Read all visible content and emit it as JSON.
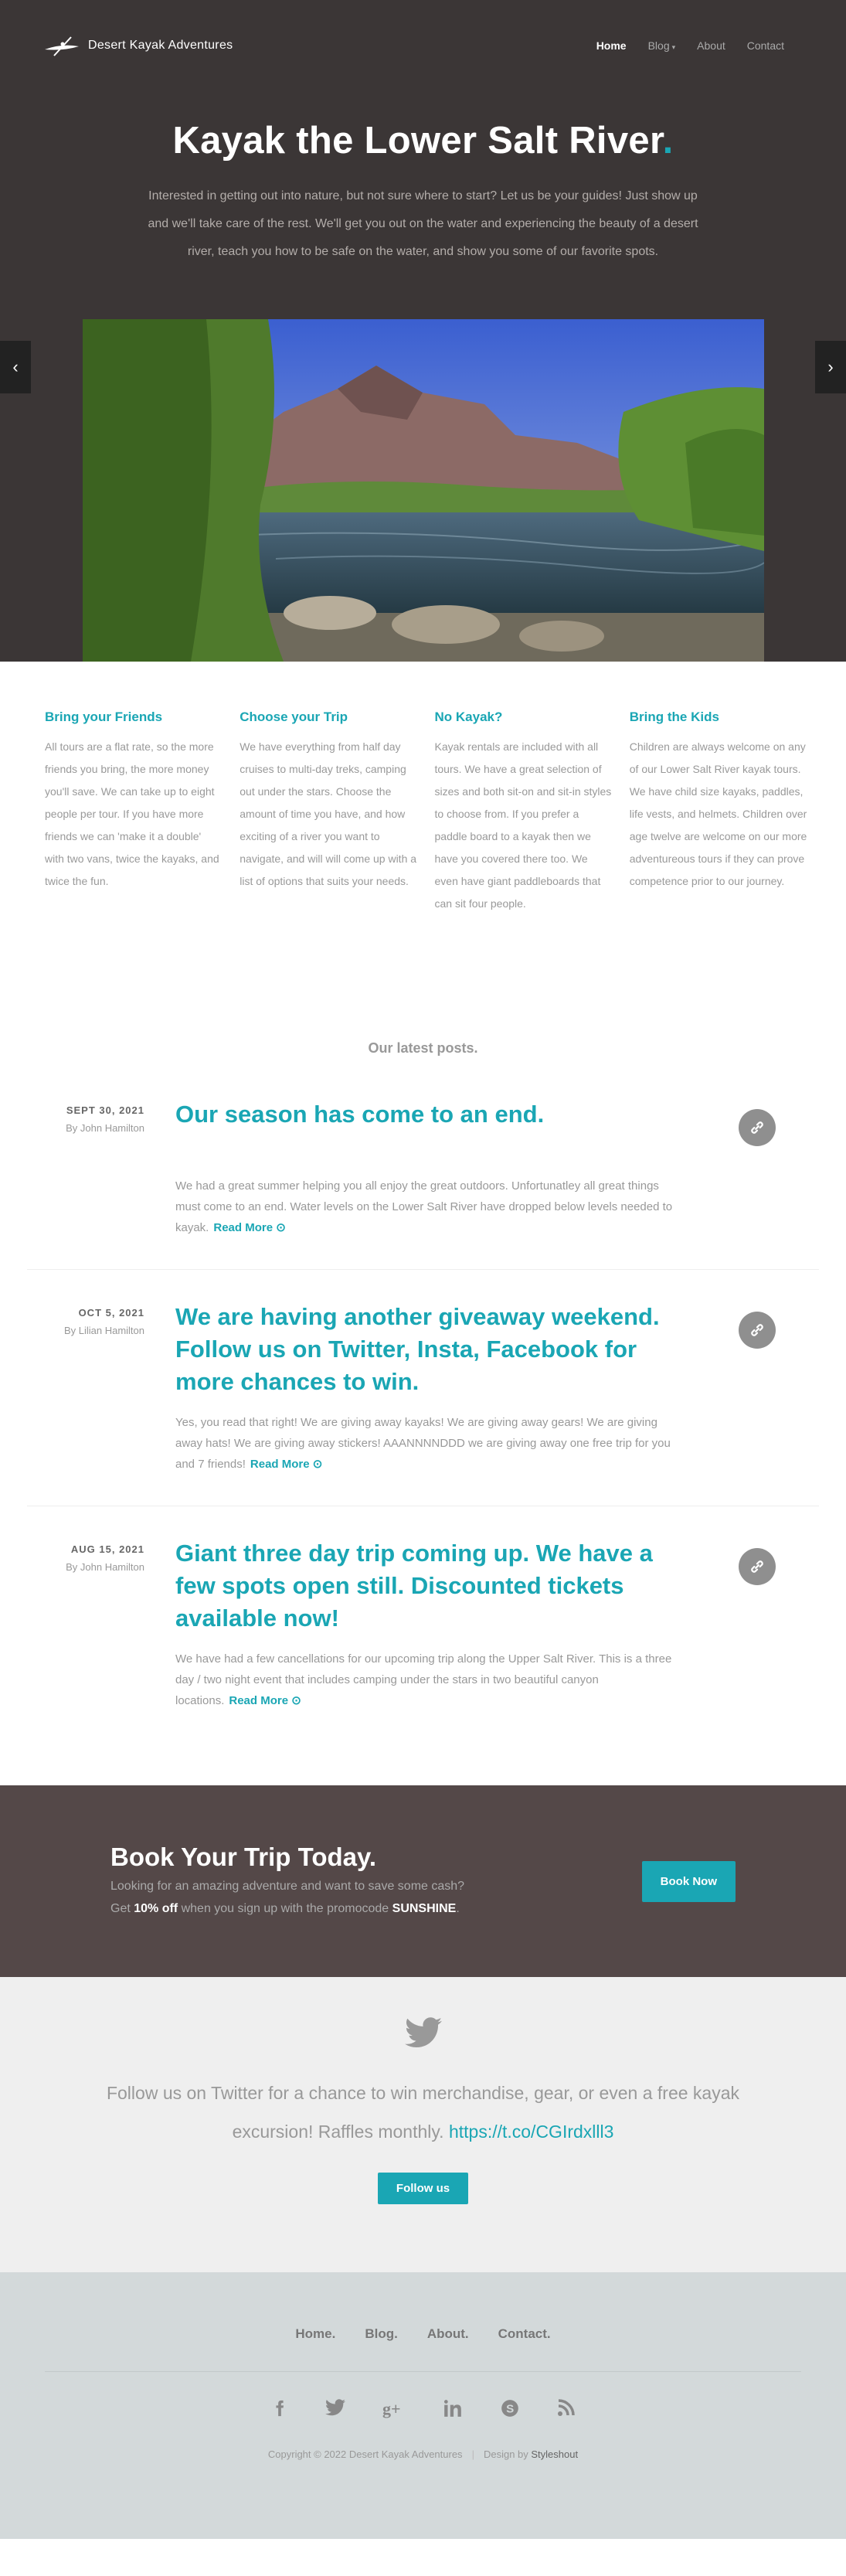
{
  "nav": {
    "brand": "Desert Kayak Adventures",
    "items": [
      {
        "label": "Home"
      },
      {
        "label": "Blog"
      },
      {
        "label": "About"
      },
      {
        "label": "Contact"
      }
    ]
  },
  "hero": {
    "title": "Kayak the Lower Salt River",
    "title_dot": ".",
    "text": "Interested in getting out into nature, but not sure where to start? Let us be your guides! Just show up and we'll take care of the rest. We'll get you out on the water and experiencing the beauty of a desert river, teach you how to be safe on the water, and show you some of our favorite spots.",
    "prev_icon": "chevron-left-icon",
    "next_icon": "chevron-right-icon"
  },
  "features": [
    {
      "title": "Bring your Friends",
      "text": "All tours are a flat rate, so the more friends you bring, the more money you'll save. We can take up to eight people per tour. If you have more friends we can 'make it a double' with two vans, twice the kayaks, and twice the fun."
    },
    {
      "title": "Choose your Trip",
      "text": "We have everything from half day cruises to multi-day treks, camping out under the stars. Choose the amount of time you have, and how exciting of a river you want to navigate, and will will come up with a list of options that suits your needs."
    },
    {
      "title": "No Kayak?",
      "text": "Kayak rentals are included with all tours. We have a great selection of sizes and both sit-on and sit-in styles to choose from. If you prefer a paddle board to a kayak then we have you covered there too. We even have giant paddleboards that can sit four people."
    },
    {
      "title": "Bring the Kids",
      "text": "Children are always welcome on any of our Lower Salt River kayak tours. We have child size kayaks, paddles, life vests, and helmets. Children over age twelve are welcome on our more adventureous tours if they can prove competence prior to our journey."
    }
  ],
  "posts": {
    "heading": "Our latest posts.",
    "items": [
      {
        "date": "SEPT 30, 2021",
        "author": "By John Hamilton",
        "title": "Our season has come to an end.",
        "excerpt": "We had a great summer helping you all enjoy the great outdoors. Unfortunatley all great things must come to an end. Water levels on the Lower Salt River have dropped below levels needed to kayak.",
        "read_more": "Read More"
      },
      {
        "date": "OCT 5, 2021",
        "author": "By Lilian Hamilton",
        "title": "We are having another giveaway weekend. Follow us on Twitter, Insta, Facebook for more chances to win.",
        "excerpt": "Yes, you read that right! We are giving away kayaks! We are giving away gears! We are giving away hats! We are giving away stickers! AAANNNNDDD we are giving away one free trip for you and 7 friends!",
        "read_more": "Read More"
      },
      {
        "date": "AUG 15, 2021",
        "author": "By John Hamilton",
        "title": "Giant three day trip coming up. We have a few spots open still. Discounted tickets available now!",
        "excerpt": "We have had a few cancellations for our upcoming trip along the Upper Salt River. This is a three day / two night event that includes camping under the stars in two beautiful canyon locations.",
        "read_more": "Read More"
      }
    ]
  },
  "cta": {
    "title": "Book Your Trip Today.",
    "line1": "Looking for an amazing adventure and want to save some cash?",
    "line2_pre": "Get ",
    "discount": "10% off",
    "line2_mid": " when you sign up with the promocode ",
    "promo": "SUNSHINE",
    "line2_end": ".",
    "button": "Book Now"
  },
  "twitter": {
    "icon": "twitter-icon",
    "text": "Follow us on Twitter for a chance to win merchandise, gear, or even a free kayak excursion! Raffles monthly.",
    "link": "https://t.co/CGIrdxlll3",
    "button": "Follow us"
  },
  "footer": {
    "nav": [
      "Home.",
      "Blog.",
      "About.",
      "Contact."
    ],
    "social": [
      "facebook-icon",
      "twitter-icon",
      "google-plus-icon",
      "linkedin-icon",
      "skype-icon",
      "rss-icon"
    ],
    "copyright": "Copyright © 2022 Desert Kayak Adventures",
    "design_by": "Design by",
    "designer": "Styleshout"
  },
  "colors": {
    "accent": "#1aa6b4",
    "hero_bg": "#3b3636",
    "cta_bg": "#544848"
  }
}
